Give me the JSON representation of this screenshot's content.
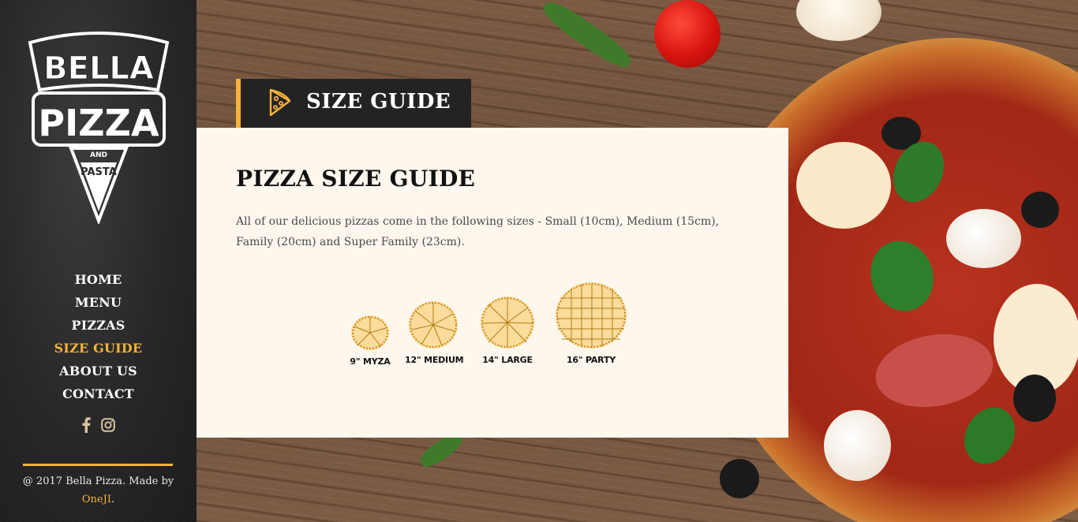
{
  "brand": {
    "logo_line1": "BELLA",
    "logo_line2": "PIZZA",
    "logo_line3": "AND",
    "logo_line4": "PASTA"
  },
  "nav": {
    "items": [
      {
        "label": "HOME",
        "active": false
      },
      {
        "label": "MENU",
        "active": false
      },
      {
        "label": "PIZZAS",
        "active": false
      },
      {
        "label": "SIZE GUIDE",
        "active": true
      },
      {
        "label": "ABOUT US",
        "active": false
      },
      {
        "label": "CONTACT",
        "active": false
      }
    ]
  },
  "social": {
    "icons": [
      "facebook-icon",
      "instagram-icon"
    ]
  },
  "footer": {
    "copyright": "@ 2017 Bella Pizza. Made by",
    "author": "OneJI",
    "suffix": "."
  },
  "header": {
    "title": "SIZE GUIDE",
    "icon": "pizza-slice-icon"
  },
  "content": {
    "title": "PIZZA SIZE GUIDE",
    "description": "All of our delicious pizzas come in the following sizes - Small (10cm), Medium (15cm), Family (20cm) and Super Family (23cm).",
    "sizes": [
      {
        "label": "9\" MYZA"
      },
      {
        "label": "12\" MEDIUM"
      },
      {
        "label": "14\" LARGE"
      },
      {
        "label": "16\" PARTY"
      }
    ]
  },
  "colors": {
    "accent": "#f5b23b",
    "sidebar": "#262626",
    "card": "#fef7ee",
    "text": "#4a4a4a"
  }
}
